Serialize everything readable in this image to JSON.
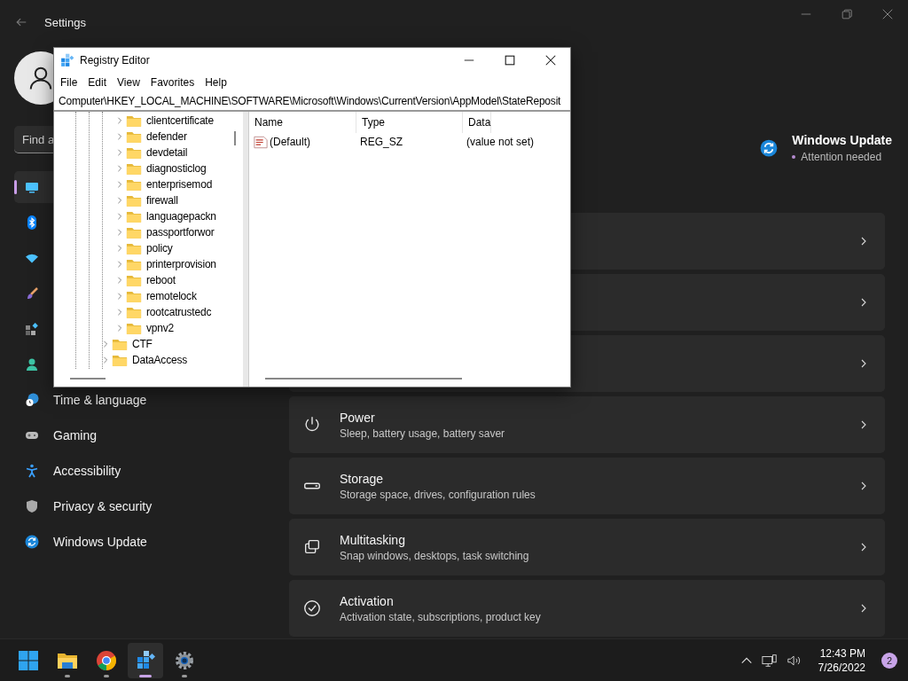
{
  "settings_window": {
    "title": "Settings"
  },
  "sidebar": {
    "search": {
      "placeholder": "Find a"
    },
    "items": [
      {
        "kind": "system",
        "selected": true
      },
      {
        "kind": "bluetooth",
        "selected": false
      },
      {
        "kind": "network",
        "selected": false
      },
      {
        "kind": "personalization",
        "selected": false
      },
      {
        "kind": "apps",
        "selected": false
      },
      {
        "kind": "accounts",
        "selected": false
      },
      {
        "kind": "time",
        "label": "Time & language",
        "selected": false
      },
      {
        "kind": "gaming",
        "label": "Gaming",
        "selected": false
      },
      {
        "kind": "accessibility",
        "label": "Accessibility",
        "selected": false
      },
      {
        "kind": "privacy",
        "label": "Privacy & security",
        "selected": false
      },
      {
        "kind": "update",
        "label": "Windows Update",
        "selected": false
      }
    ]
  },
  "header": {
    "update_title": "Windows Update",
    "update_status": "Attention needed"
  },
  "cards": [
    {
      "kind": "covered"
    },
    {
      "kind": "covered"
    },
    {
      "kind": "covered"
    },
    {
      "kind": "power",
      "title": "Power",
      "subtitle": "Sleep, battery usage, battery saver"
    },
    {
      "kind": "storage",
      "title": "Storage",
      "subtitle": "Storage space, drives, configuration rules"
    },
    {
      "kind": "multitasking",
      "title": "Multitasking",
      "subtitle": "Snap windows, desktops, task switching"
    },
    {
      "kind": "activation",
      "title": "Activation",
      "subtitle": "Activation state, subscriptions, product key"
    }
  ],
  "registry_editor": {
    "title": "Registry Editor",
    "menu": [
      "File",
      "Edit",
      "View",
      "Favorites",
      "Help"
    ],
    "address": "Computer\\HKEY_LOCAL_MACHINE\\SOFTWARE\\Microsoft\\Windows\\CurrentVersion\\AppModel\\StateReposit",
    "tree": [
      {
        "children": [
          {
            "label": "clientcertificate"
          },
          {
            "label": "defender"
          },
          {
            "label": "devdetail"
          },
          {
            "label": "diagnosticlog"
          },
          {
            "label": "enterprisemod"
          },
          {
            "label": "firewall"
          },
          {
            "label": "languagepackn"
          },
          {
            "label": "passportforwor"
          },
          {
            "label": "policy"
          },
          {
            "label": "printerprovision"
          },
          {
            "label": "reboot"
          },
          {
            "label": "remotelock"
          },
          {
            "label": "rootcatrustedc"
          },
          {
            "label": "vpnv2"
          }
        ]
      },
      {
        "label": "CTF"
      },
      {
        "label": "DataAccess"
      }
    ],
    "columns": [
      "Name",
      "Type",
      "Data"
    ],
    "values": [
      {
        "name": "(Default)",
        "type": "REG_SZ",
        "data": "(value not set)"
      }
    ]
  },
  "taskbar": {
    "apps": [
      {
        "kind": "start",
        "running": false,
        "selected": false
      },
      {
        "kind": "explorer",
        "running": true,
        "selected": false
      },
      {
        "kind": "browser",
        "running": true,
        "selected": false
      },
      {
        "kind": "regedit",
        "running": true,
        "selected": true
      },
      {
        "kind": "settings",
        "running": true,
        "selected": false
      }
    ],
    "time": "12:43 PM",
    "date": "7/26/2022",
    "notification_count": "2"
  }
}
